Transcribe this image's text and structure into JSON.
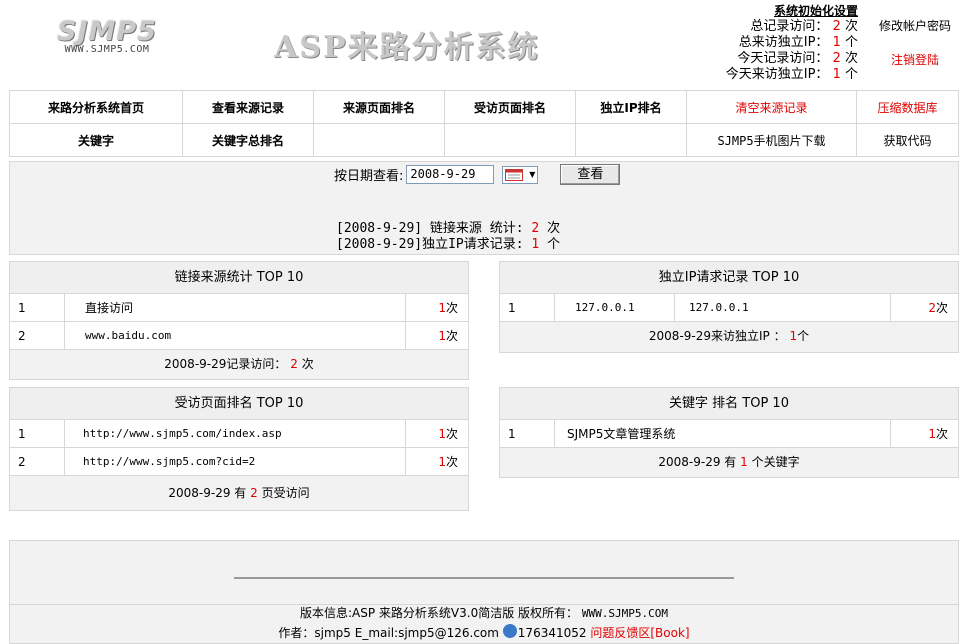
{
  "header": {
    "logo_main": "SJMP5",
    "logo_sub": "WWW.SJMP5.COM",
    "title": "ASP来路分析系统",
    "stats_title": "系统初始化设置",
    "stats": [
      {
        "label": "总记录访问：",
        "value": "2",
        "unit": "次"
      },
      {
        "label": "总来访独立IP：",
        "value": "1",
        "unit": "个"
      },
      {
        "label": "今天记录访问：",
        "value": "2",
        "unit": "次"
      },
      {
        "label": "今天来访独立IP：",
        "value": "1",
        "unit": "个"
      }
    ],
    "change_password": "修改帐户密码",
    "logout": "注销登陆"
  },
  "nav": {
    "row1": [
      "来路分析系统首页",
      "查看来源记录",
      "来源页面排名",
      "受访页面排名",
      "独立IP排名",
      "清空来源记录",
      "压缩数据库"
    ],
    "row2": [
      "关键字",
      "关键字总排名",
      "",
      "",
      "",
      "SJMP5手机图片下载",
      "获取代码"
    ],
    "colors": {
      "danger": "#e00000"
    }
  },
  "query": {
    "label": "按日期查看:",
    "date_value": "2008-9-29",
    "button": "查看",
    "result_line1_prefix": "[2008-9-29] 链接来源 统计:",
    "result_line1_value": "2",
    "result_line1_unit": "次",
    "result_line2_prefix": "[2008-9-29]独立IP请求记录:",
    "result_line2_value": "1",
    "result_line2_unit": "个"
  },
  "link_stats": {
    "title": "链接来源统计 TOP 10",
    "rows": [
      {
        "rank": "1",
        "source": "直接访问",
        "count": "1",
        "unit": "次"
      },
      {
        "rank": "2",
        "source": "www.baidu.com",
        "count": "1",
        "unit": "次"
      }
    ],
    "footer_prefix": "2008-9-29记录访问：",
    "footer_value": "2",
    "footer_unit": "次"
  },
  "ip_stats": {
    "title": "独立IP请求记录 TOP 10",
    "rows": [
      {
        "rank": "1",
        "ip": "127.0.0.1",
        "ip2": "127.0.0.1",
        "count": "2",
        "unit": "次"
      }
    ],
    "footer_prefix": "2008-9-29来访独立IP ：",
    "footer_value": "1",
    "footer_unit": "个"
  },
  "page_stats": {
    "title": "受访页面排名 TOP 10",
    "rows": [
      {
        "rank": "1",
        "url": "http://www.sjmp5.com/index.asp",
        "count": "1",
        "unit": "次"
      },
      {
        "rank": "2",
        "url": "http://www.sjmp5.com?cid=2",
        "count": "1",
        "unit": "次"
      }
    ],
    "footer_prefix": "2008-9-29 有",
    "footer_value": "2",
    "footer_unit": "页受访问"
  },
  "keyword_stats": {
    "title": "关键字 排名 TOP 10",
    "rows": [
      {
        "rank": "1",
        "keyword": "SJMP5文章管理系统",
        "count": "1",
        "unit": "次"
      }
    ],
    "footer_prefix": "2008-9-29 有",
    "footer_value": "1",
    "footer_unit": "个关键字"
  },
  "footer": {
    "version_text": "版本信息:ASP 来路分析系统V3.0简洁版  版权所有：",
    "site": "WWW.SJMP5.COM",
    "author_text": "作者：sjmp5 E_mail:sjmp5@126.com",
    "qq": "176341052",
    "feedback": "问题反馈区[Book]"
  }
}
